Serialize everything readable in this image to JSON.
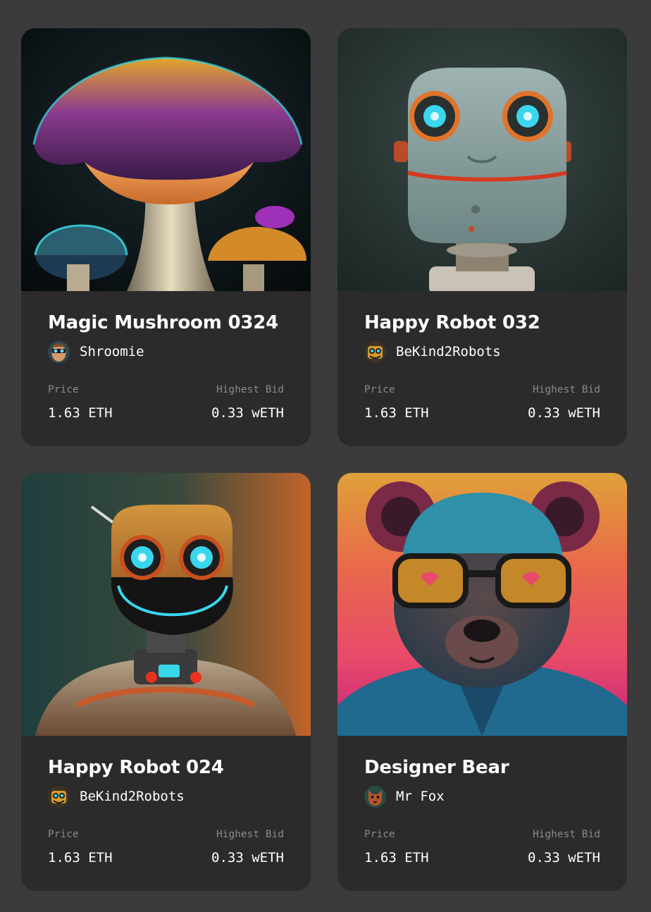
{
  "cards": [
    {
      "name": "Magic Mushroom 0324",
      "artist": "Shroomie",
      "price_label": "Price",
      "price": "1.63 ETH",
      "bid_label": "Highest Bid",
      "bid": "0.33 wETH",
      "image_icon": "mushroom-artwork",
      "avatar_icon": "mushroom-avatar"
    },
    {
      "name": "Happy Robot 032",
      "artist": "BeKind2Robots",
      "price_label": "Price",
      "price": "1.63 ETH",
      "bid_label": "Highest Bid",
      "bid": "0.33 wETH",
      "image_icon": "gray-robot-artwork",
      "avatar_icon": "robot-avatar"
    },
    {
      "name": "Happy Robot 024",
      "artist": "BeKind2Robots",
      "price_label": "Price",
      "price": "1.63 ETH",
      "bid_label": "Highest Bid",
      "bid": "0.33 wETH",
      "image_icon": "orange-robot-artwork",
      "avatar_icon": "robot-avatar"
    },
    {
      "name": "Designer Bear",
      "artist": "Mr Fox",
      "price_label": "Price",
      "price": "1.63 ETH",
      "bid_label": "Highest Bid",
      "bid": "0.33 wETH",
      "image_icon": "bear-artwork",
      "avatar_icon": "fox-avatar"
    }
  ],
  "colors": {
    "page_background": "#3b3b3b",
    "card_background": "#2b2b2b",
    "label_gray": "#8a8a8a",
    "text_white": "#ffffff"
  }
}
